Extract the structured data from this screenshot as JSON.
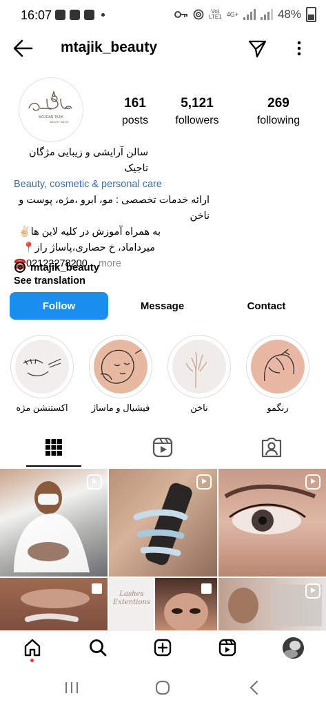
{
  "status": {
    "time": "16:07",
    "network_top": "Vo)",
    "network_bottom": "LTE1",
    "net_type": "4G+",
    "battery": "48%"
  },
  "header": {
    "username": "mtajik_beauty",
    "icons": [
      "back-arrow-icon",
      "direct-send-icon",
      "more-vertical-icon"
    ]
  },
  "profile": {
    "logo_brand": "MOJGAN TAJIK",
    "logo_sub": "BEAUTY SALON",
    "stats": [
      {
        "value": "161",
        "label": "posts"
      },
      {
        "value": "5,121",
        "label": "followers"
      },
      {
        "value": "269",
        "label": "following"
      }
    ],
    "bio": {
      "name": "سالن آرایشی و زیبایی مژگان تاجیک",
      "category": "Beauty, cosmetic & personal care",
      "line1": "ارائه خدمات تخصصی : مو، ابرو ،مژه، پوست و ناخن",
      "line2": "به همراه آموزش در کلیه لاین ها✌🏻",
      "line3": "میرداماد، خ حصاری،پاساژ راز📍",
      "phone": "☎️02122278200",
      "more": "... more",
      "see_translation": "See translation"
    },
    "threads_handle": "mtajik_beauty"
  },
  "actions": {
    "follow": "Follow",
    "message": "Message",
    "contact": "Contact",
    "follow_color": "#1a8ff0"
  },
  "highlights": [
    {
      "label": "اکستنشن مژه"
    },
    {
      "label": "فیشیال و ماساژ"
    },
    {
      "label": "ناخن"
    },
    {
      "label": "رنگمو"
    }
  ],
  "tabs": [
    "grid-icon",
    "reels-icon",
    "tagged-icon"
  ],
  "grid_cells": [
    {
      "badge": "reel"
    },
    {
      "badge": "reel"
    },
    {
      "badge": "reel"
    },
    {
      "badge": "multi"
    },
    {
      "badge": "none",
      "text": "Lashes Extentions"
    },
    {
      "badge": "multi"
    },
    {
      "badge": "reel"
    }
  ],
  "bottom_nav": [
    "home-icon",
    "search-icon",
    "create-icon",
    "reels-icon",
    "profile-avatar"
  ],
  "system_nav": [
    "recents-icon",
    "home-circle-icon",
    "back-chevron-icon"
  ]
}
